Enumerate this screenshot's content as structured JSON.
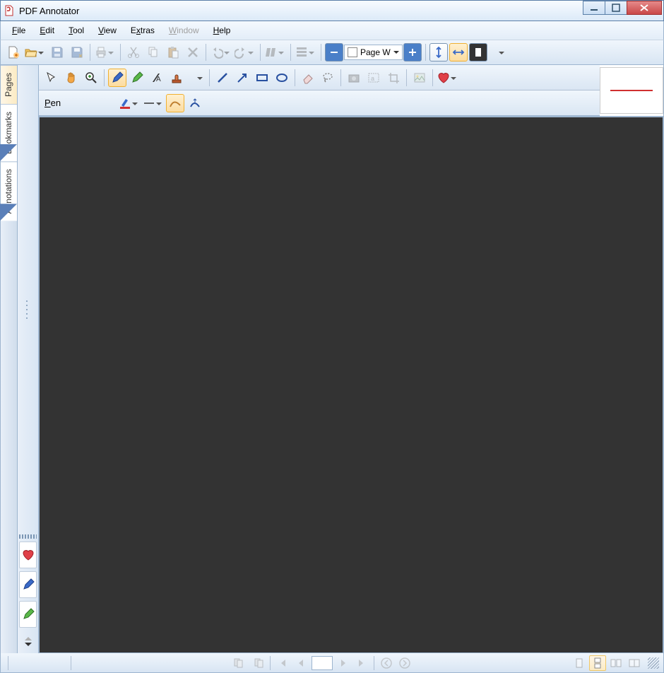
{
  "title": "PDF Annotator",
  "menu": {
    "file": "File",
    "edit": "Edit",
    "tool": "Tool",
    "view": "View",
    "extras": "Extras",
    "window": "Window",
    "help": "Help"
  },
  "zoom": {
    "label": "Page W"
  },
  "side_tabs": {
    "pages": "Pages",
    "bookmarks": "Bookmarks",
    "annotations": "Annotations"
  },
  "pen_toolbar": {
    "label": "Pen"
  }
}
